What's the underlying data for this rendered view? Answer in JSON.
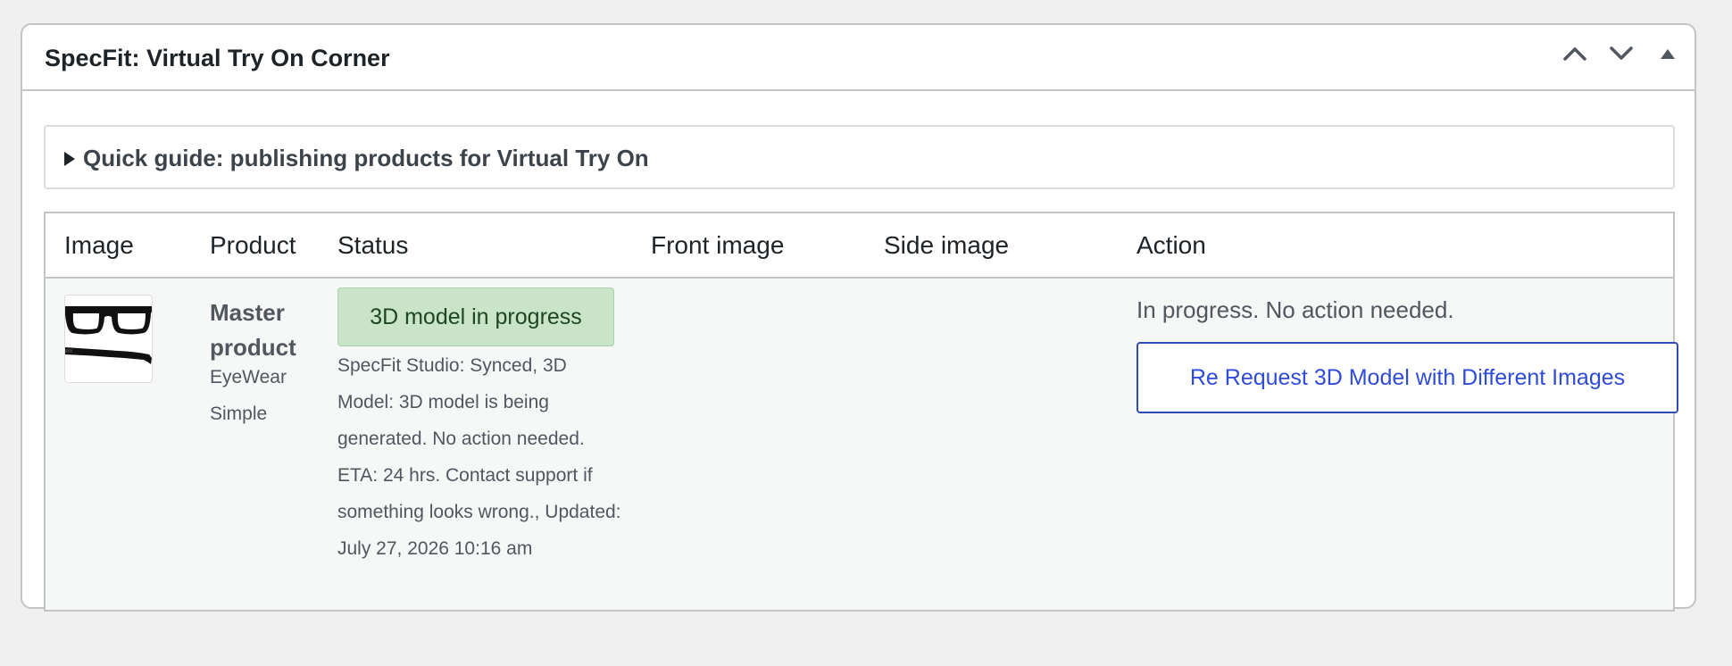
{
  "postbox": {
    "title": "SpecFit: Virtual Try On Corner"
  },
  "guide": {
    "label": "Quick guide: publishing products for Virtual Try On"
  },
  "table": {
    "headers": {
      "image": "Image",
      "product": "Product",
      "status": "Status",
      "front_image": "Front image",
      "side_image": "Side image",
      "action": "Action"
    },
    "row": {
      "product_name": "Master product",
      "category": "EyeWear",
      "product_type": "Simple",
      "status_badge": "3D model in progress",
      "status_detail": "SpecFit Studio: Synced, 3D Model: 3D model is being generated. No action needed. ETA: 24 hrs. Contact support if something looks wrong., Updated: July 27, 2026 10:16 am",
      "action_text": "In progress. No action needed.",
      "action_button": "Re Request 3D Model with Different Images"
    }
  },
  "icons": {
    "move_up": "chevron-up-icon",
    "move_down": "chevron-down-icon",
    "toggle": "triangle-up-icon",
    "disclosure": "triangle-right-icon",
    "thumbnail": "eyeglasses-icon"
  },
  "colors": {
    "status_badge_bg": "#c9e4c9",
    "action_button_text": "#2f4bd8"
  }
}
